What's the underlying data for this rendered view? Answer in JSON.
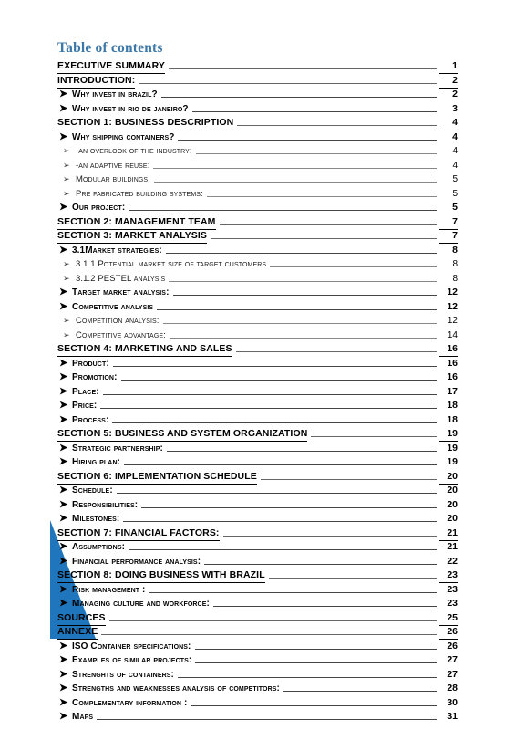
{
  "document": {
    "title": "Table of contents",
    "title_color": "#3C78A8",
    "accent_color": "#1F76BC"
  },
  "entries": [
    {
      "level": "section",
      "bullet": "none",
      "label": "EXECUTIVE SUMMARY",
      "page": "1"
    },
    {
      "level": "section",
      "bullet": "none",
      "label": "INTRODUCTION:",
      "page": "2"
    },
    {
      "level": "lvl1",
      "bullet": "arrow-solid",
      "label": "Why invest in Brazil?",
      "page": "2"
    },
    {
      "level": "lvl1",
      "bullet": "arrow-solid",
      "label": "Why invest in Rio de Janeiro?",
      "page": "3"
    },
    {
      "level": "section",
      "bullet": "none",
      "label": "SECTION 1: BUSINESS DESCRIPTION",
      "page": "4"
    },
    {
      "level": "lvl1",
      "bullet": "arrow-solid",
      "label": "Why shipping containers?",
      "page": "4"
    },
    {
      "level": "lvl2",
      "bullet": "arrow-outline",
      "label": "-An overlook of the industry:",
      "page": "4"
    },
    {
      "level": "lvl2",
      "bullet": "arrow-outline",
      "label": "-An adaptive reuse:",
      "page": "4"
    },
    {
      "level": "lvl2",
      "bullet": "arrow-outline",
      "label": "Modular Buildings:",
      "page": "5"
    },
    {
      "level": "lvl2",
      "bullet": "arrow-outline",
      "label": "Pre fabricated building systems:",
      "page": "5"
    },
    {
      "level": "lvl1",
      "bullet": "arrow-solid",
      "label": "Our project:",
      "page": "5"
    },
    {
      "level": "section",
      "bullet": "none",
      "label": "SECTION 2: MANAGEMENT TEAM",
      "page": "7"
    },
    {
      "level": "section",
      "bullet": "none",
      "label": "SECTION 3: MARKET ANALYSIS",
      "page": "7"
    },
    {
      "level": "lvl1",
      "bullet": "arrow-solid",
      "label": "3.1Market strategies:",
      "page": "8",
      "literal": true,
      "smallcaps": true
    },
    {
      "level": "lvl2",
      "bullet": "arrow-outline",
      "label": "3.1.1  Potential market size of target customers",
      "page": "8",
      "literal": true,
      "smallcaps": true
    },
    {
      "level": "lvl2",
      "bullet": "arrow-outline",
      "label": "3.1.2 PESTEL analysis",
      "page": "8",
      "literal": true,
      "smallcaps": true
    },
    {
      "level": "lvl1",
      "bullet": "arrow-solid",
      "label": "Target market analysis:",
      "page": "12"
    },
    {
      "level": "lvl1",
      "bullet": "arrow-solid",
      "label": "Competitive analysis",
      "page": "12"
    },
    {
      "level": "lvl2",
      "bullet": "arrow-outline",
      "label": "Competition analysis:",
      "page": "12"
    },
    {
      "level": "lvl2",
      "bullet": "arrow-outline",
      "label": "Competitive advantage:",
      "page": "14"
    },
    {
      "level": "section",
      "bullet": "none",
      "label": "SECTION 4: MARKETING AND SALES",
      "page": "16"
    },
    {
      "level": "lvl1",
      "bullet": "arrow-solid",
      "label": "Product:",
      "page": "16"
    },
    {
      "level": "lvl1",
      "bullet": "arrow-solid",
      "label": "Promotion:",
      "page": "16"
    },
    {
      "level": "lvl1",
      "bullet": "arrow-solid",
      "label": "Place:",
      "page": "17"
    },
    {
      "level": "lvl1",
      "bullet": "arrow-solid",
      "label": "Price:",
      "page": "18"
    },
    {
      "level": "lvl1",
      "bullet": "arrow-solid",
      "label": "Process:",
      "page": "18"
    },
    {
      "level": "section",
      "bullet": "none",
      "label": "SECTION 5: BUSINESS AND SYSTEM ORGANIZATION",
      "page": "19"
    },
    {
      "level": "lvl1",
      "bullet": "arrow-solid",
      "label": "Strategic partnership:",
      "page": "19"
    },
    {
      "level": "lvl1",
      "bullet": "arrow-solid",
      "label": "Hiring plan:",
      "page": "19"
    },
    {
      "level": "section",
      "bullet": "none",
      "label": "SECTION 6: IMPLEMENTATION SCHEDULE",
      "page": "20"
    },
    {
      "level": "lvl1",
      "bullet": "arrow-solid",
      "label": "Schedule:",
      "page": "20"
    },
    {
      "level": "lvl1",
      "bullet": "arrow-solid",
      "label": "Responsibilities:",
      "page": "20"
    },
    {
      "level": "lvl1",
      "bullet": "arrow-solid",
      "label": "Milestones:",
      "page": "20"
    },
    {
      "level": "section",
      "bullet": "none",
      "label": "SECTION 7: FINANCIAL FACTORS:",
      "page": "21"
    },
    {
      "level": "lvl1",
      "bullet": "arrow-solid",
      "label": "Assumptions:",
      "page": "21"
    },
    {
      "level": "lvl1",
      "bullet": "arrow-solid",
      "label": "Financial performance analysis:",
      "page": "22"
    },
    {
      "level": "section",
      "bullet": "none",
      "label": "SECTION 8: DOING BUSINESS WITH BRAZIL",
      "page": "23"
    },
    {
      "level": "lvl1",
      "bullet": "arrow-solid",
      "label": "Risk management :",
      "page": "23"
    },
    {
      "level": "lvl1",
      "bullet": "arrow-solid",
      "label": "Managing culture and workforce:",
      "page": "23"
    },
    {
      "level": "section",
      "bullet": "none",
      "label": "SOURCES",
      "page": "25"
    },
    {
      "level": "section",
      "bullet": "none",
      "label": "ANNEXE",
      "page": "26"
    },
    {
      "level": "lvl1",
      "bullet": "arrow-solid",
      "label": "ISO Container specifications:",
      "page": "26",
      "literal": true,
      "smallcaps": true
    },
    {
      "level": "lvl1",
      "bullet": "arrow-solid",
      "label": "Examples of similar projects:",
      "page": "27"
    },
    {
      "level": "lvl1",
      "bullet": "arrow-solid",
      "label": "Strenghts of containers:",
      "page": "27"
    },
    {
      "level": "lvl1",
      "bullet": "arrow-solid",
      "label": "Strengths and weaknesses analysis of competitors:",
      "page": "28"
    },
    {
      "level": "lvl1",
      "bullet": "arrow-solid",
      "label": "Complementary information :",
      "page": "30"
    },
    {
      "level": "lvl1",
      "bullet": "arrow-solid",
      "label": "Maps",
      "page": "31"
    }
  ]
}
